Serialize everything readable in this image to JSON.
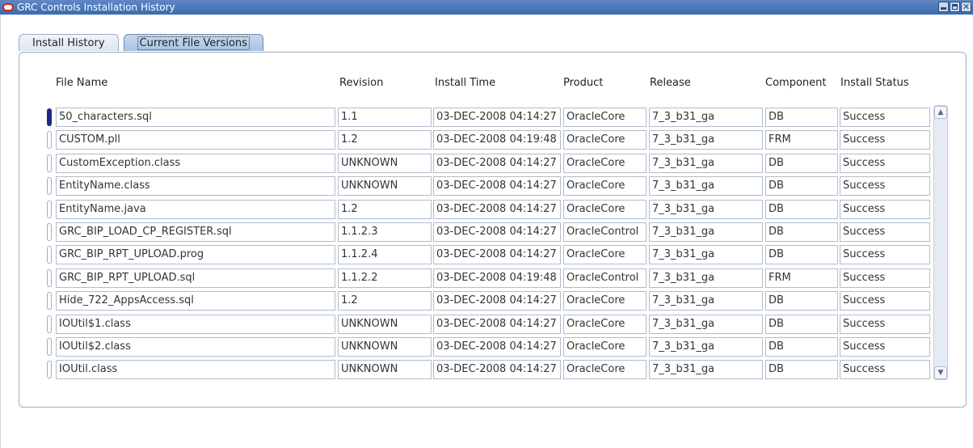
{
  "window": {
    "title": "GRC Controls Installation History",
    "icon": "oracle-logo-icon",
    "title_bar_color": "#4a78bb"
  },
  "tabs": [
    {
      "label": "Install History",
      "active": false
    },
    {
      "label": "Current File Versions",
      "active": true
    }
  ],
  "table": {
    "headers": {
      "file_name": "File Name",
      "revision": "Revision",
      "install_time": "Install Time",
      "product": "Product",
      "release": "Release",
      "component": "Component",
      "install_status": "Install Status"
    },
    "rows": [
      {
        "file_name": "50_characters.sql",
        "revision": "1.1",
        "install_time": "03-DEC-2008 04:14:27",
        "product": "OracleCore",
        "release": "7_3_b31_ga",
        "component": "DB",
        "install_status": "Success"
      },
      {
        "file_name": "CUSTOM.pll",
        "revision": "1.2",
        "install_time": "03-DEC-2008 04:19:48",
        "product": "OracleCore",
        "release": "7_3_b31_ga",
        "component": "FRM",
        "install_status": "Success"
      },
      {
        "file_name": "CustomException.class",
        "revision": "UNKNOWN",
        "install_time": "03-DEC-2008 04:14:27",
        "product": "OracleCore",
        "release": "7_3_b31_ga",
        "component": "DB",
        "install_status": "Success"
      },
      {
        "file_name": "EntityName.class",
        "revision": "UNKNOWN",
        "install_time": "03-DEC-2008 04:14:27",
        "product": "OracleCore",
        "release": "7_3_b31_ga",
        "component": "DB",
        "install_status": "Success"
      },
      {
        "file_name": "EntityName.java",
        "revision": "1.2",
        "install_time": "03-DEC-2008 04:14:27",
        "product": "OracleCore",
        "release": "7_3_b31_ga",
        "component": "DB",
        "install_status": "Success"
      },
      {
        "file_name": "GRC_BIP_LOAD_CP_REGISTER.sql",
        "revision": "1.1.2.3",
        "install_time": "03-DEC-2008 04:14:27",
        "product": "OracleControl",
        "release": "7_3_b31_ga",
        "component": "DB",
        "install_status": "Success"
      },
      {
        "file_name": "GRC_BIP_RPT_UPLOAD.prog",
        "revision": "1.1.2.4",
        "install_time": "03-DEC-2008 04:14:27",
        "product": "OracleCore",
        "release": "7_3_b31_ga",
        "component": "DB",
        "install_status": "Success"
      },
      {
        "file_name": "GRC_BIP_RPT_UPLOAD.sql",
        "revision": "1.1.2.2",
        "install_time": "03-DEC-2008 04:19:48",
        "product": "OracleControl",
        "release": "7_3_b31_ga",
        "component": "FRM",
        "install_status": "Success"
      },
      {
        "file_name": "Hide_722_AppsAccess.sql",
        "revision": "1.2",
        "install_time": "03-DEC-2008 04:14:27",
        "product": "OracleCore",
        "release": "7_3_b31_ga",
        "component": "DB",
        "install_status": "Success"
      },
      {
        "file_name": "IOUtil$1.class",
        "revision": "UNKNOWN",
        "install_time": "03-DEC-2008 04:14:27",
        "product": "OracleCore",
        "release": "7_3_b31_ga",
        "component": "DB",
        "install_status": "Success"
      },
      {
        "file_name": "IOUtil$2.class",
        "revision": "UNKNOWN",
        "install_time": "03-DEC-2008 04:14:27",
        "product": "OracleCore",
        "release": "7_3_b31_ga",
        "component": "DB",
        "install_status": "Success"
      },
      {
        "file_name": "IOUtil.class",
        "revision": "UNKNOWN",
        "install_time": "03-DEC-2008 04:14:27",
        "product": "OracleCore",
        "release": "7_3_b31_ga",
        "component": "DB",
        "install_status": "Success"
      }
    ]
  }
}
